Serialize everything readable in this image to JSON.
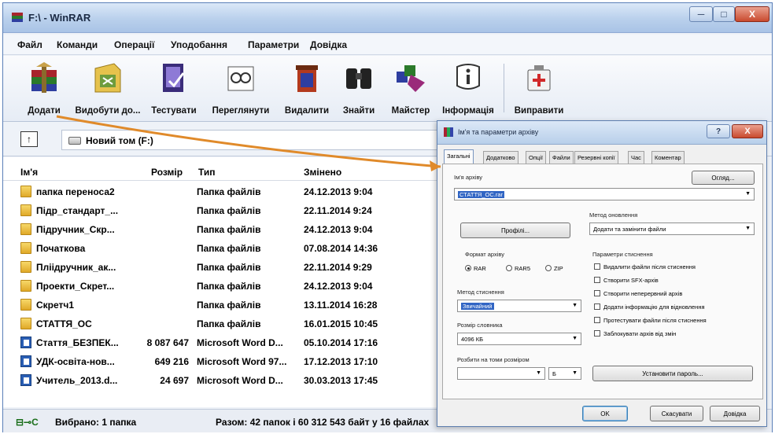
{
  "window": {
    "title": "F:\\ - WinRAR",
    "minimize": "─",
    "maximize": "□",
    "close": "X"
  },
  "menu": [
    "Файл",
    "Команди",
    "Операції",
    "Уподобання",
    "Параметри",
    "Довідка"
  ],
  "toolbar": [
    {
      "label": "Додати",
      "icon": "add-archive-icon"
    },
    {
      "label": "Видобути до...",
      "icon": "extract-to-icon"
    },
    {
      "label": "Тестувати",
      "icon": "test-icon"
    },
    {
      "label": "Переглянути",
      "icon": "view-icon"
    },
    {
      "label": "Видалити",
      "icon": "delete-icon"
    },
    {
      "label": "Знайти",
      "icon": "find-icon"
    },
    {
      "label": "Майстер",
      "icon": "wizard-icon"
    },
    {
      "label": "Інформація",
      "icon": "info-icon"
    },
    {
      "label": "Виправити",
      "icon": "repair-icon"
    }
  ],
  "address": {
    "up": "↑",
    "path": "Новий том (F:)"
  },
  "columns": {
    "name": "Ім'я",
    "size": "Розмір",
    "type": "Тип",
    "modified": "Змінено"
  },
  "files": [
    {
      "name": "папка переноса2",
      "size": "",
      "type": "Папка файлів",
      "modified": "24.12.2013 9:04",
      "kind": "folder"
    },
    {
      "name": "Підр_стандарт_...",
      "size": "",
      "type": "Папка файлів",
      "modified": "22.11.2014 9:24",
      "kind": "folder"
    },
    {
      "name": "Підручник_Скр...",
      "size": "",
      "type": "Папка файлів",
      "modified": "24.12.2013 9:04",
      "kind": "folder"
    },
    {
      "name": "Початкова",
      "size": "",
      "type": "Папка файлів",
      "modified": "07.08.2014 14:36",
      "kind": "folder"
    },
    {
      "name": "Пліідручник_ак...",
      "size": "",
      "type": "Папка файлів",
      "modified": "22.11.2014 9:29",
      "kind": "folder"
    },
    {
      "name": "Проекти_Скрет...",
      "size": "",
      "type": "Папка файлів",
      "modified": "24.12.2013 9:04",
      "kind": "folder"
    },
    {
      "name": "Скретч1",
      "size": "",
      "type": "Папка файлів",
      "modified": "13.11.2014 16:28",
      "kind": "folder"
    },
    {
      "name": "СТАТТЯ_ОС",
      "size": "",
      "type": "Папка файлів",
      "modified": "16.01.2015 10:45",
      "kind": "folder"
    },
    {
      "name": "Стаття_БЕЗПЕК...",
      "size": "8 087 647",
      "type": "Microsoft Word D...",
      "modified": "05.10.2014 17:16",
      "kind": "doc"
    },
    {
      "name": "УДК-освіта-нов...",
      "size": "649 216",
      "type": "Microsoft Word 97...",
      "modified": "17.12.2013 17:10",
      "kind": "doc"
    },
    {
      "name": "Учитель_2013.d...",
      "size": "24 697",
      "type": "Microsoft Word D...",
      "modified": "30.03.2013 17:45",
      "kind": "doc"
    }
  ],
  "status": {
    "icon": "⊟⊸C",
    "left": "Вибрано: 1 папка",
    "right": "Разом: 42 папок і 60 312 543 байт у 16 файлах"
  },
  "dialog": {
    "title": "Ім'я та параметри архіву",
    "help_btn": "?",
    "close_btn": "X",
    "tabs": [
      "Загальні",
      "Додатково",
      "Опції",
      "Файли",
      "Резервні копії",
      "Час",
      "Коментар"
    ],
    "archive_name_label": "Ім'я архіву",
    "browse": "Огляд...",
    "archive_name_value": "СТАТТЯ_ОС.rar",
    "update_method_label": "Метод оновлення",
    "profiles": "Профілі...",
    "update_method_value": "Додати та замінити файли",
    "format_label": "Формат архіву",
    "formats": [
      "RAR",
      "RAR5",
      "ZIP"
    ],
    "options_label": "Параметри стиснення",
    "options": [
      "Видалити файли після стиснення",
      "Створити SFX-архів",
      "Створити неперервний архів",
      "Додати інформацію для відновлення",
      "Протестувати файли після стиснення",
      "Заблокувати архів від змін"
    ],
    "method_label": "Метод стиснення",
    "method_value": "Звичайний",
    "dict_label": "Розмір словника",
    "dict_value": "4096 КБ",
    "split_label": "Розбити на томи розміром",
    "split_unit": "Б",
    "set_password": "Установити пароль...",
    "ok": "OK",
    "cancel": "Скасувати",
    "help": "Довідка"
  }
}
